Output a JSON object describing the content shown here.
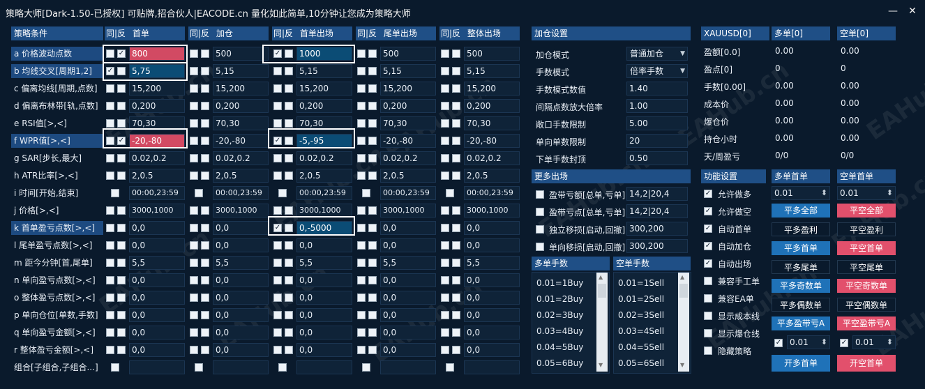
{
  "title": "策略大师[Dark-1.50-已授权]  可贴牌,招合伙人|EACODE.cn  量化如此简单,10分钟让您成为策略大师",
  "window": {
    "minimize": "—",
    "close": "✕"
  },
  "watermark": "EAHub.cn",
  "strategy": {
    "header_cond": "策略条件",
    "col_headers": [
      {
        "flag": "同|反",
        "name": "首单"
      },
      {
        "flag": "同|反",
        "name": "加仓"
      },
      {
        "flag": "同|反",
        "name": "首单出场"
      },
      {
        "flag": "同|反",
        "name": "尾单出场"
      },
      {
        "flag": "同|反",
        "name": "整体出场"
      }
    ],
    "rows": [
      {
        "label": "a 价格波动点数",
        "values": [
          "800",
          "500",
          "1000",
          "500",
          "500"
        ]
      },
      {
        "label": "b 均线交叉[周期1,2]",
        "values": [
          "5,75",
          "5,15",
          "5,15",
          "5,15",
          "5,15"
        ]
      },
      {
        "label": "c 偏离均线[周期,点数]",
        "values": [
          "15,200",
          "15,200",
          "15,200",
          "15,200",
          "15,200"
        ]
      },
      {
        "label": "d 偏离布林带[轨,点数]",
        "values": [
          "0,200",
          "0,200",
          "0,200",
          "0,200",
          "0,200"
        ]
      },
      {
        "label": "e RSI值[>,<]",
        "values": [
          "70,30",
          "70,30",
          "70,30",
          "70,30",
          "70,30"
        ]
      },
      {
        "label": "f WPR值[>,<]",
        "values": [
          "-20,-80",
          "-20,-80",
          "-5,-95",
          "-20,-80",
          "-20,-80"
        ]
      },
      {
        "label": "g SAR[步长,最大]",
        "values": [
          "0.02,0.2",
          "0.02,0.2",
          "0.02,0.2",
          "0.02,0.2",
          "0.02,0.2"
        ]
      },
      {
        "label": "h ATR比率[>,<]",
        "values": [
          "2,0.5",
          "2,0.5",
          "2,0.5",
          "2,0.5",
          "2,0.5"
        ]
      },
      {
        "label": "i 时间[开始,结束]",
        "values": [
          "00:00,23:59",
          "00:00,23:59",
          "00:00,23:59",
          "00:00,23:59",
          "00:00,23:59"
        ]
      },
      {
        "label": "j 价格[>,<]",
        "values": [
          "3000,1000",
          "3000,1000",
          "3000,1000",
          "3000,1000",
          "3000,1000"
        ]
      },
      {
        "label": "k 首单盈亏点数[>,<]",
        "values": [
          "0,0",
          "0,0",
          "0,-5000",
          "0,0",
          "0,0"
        ]
      },
      {
        "label": "l 尾单盈亏点数[>,<]",
        "values": [
          "0,0",
          "0,0",
          "0,0",
          "0,0",
          "0,0"
        ]
      },
      {
        "label": "m 距今分钟[首,尾单]",
        "values": [
          "5,5",
          "5,5",
          "5,5",
          "5,5",
          "5,5"
        ]
      },
      {
        "label": "n 单向盈亏点数[>,<]",
        "values": [
          "0,0",
          "0,0",
          "0,0",
          "0,0",
          "0,0"
        ]
      },
      {
        "label": "o 整体盈亏点数[>,<]",
        "values": [
          "0,0",
          "0,0",
          "0,0",
          "0,0",
          "0,0"
        ]
      },
      {
        "label": "p 单向仓位[单数,手数]",
        "values": [
          "0,0",
          "0,0",
          "0,0",
          "0,0",
          "0,0"
        ]
      },
      {
        "label": "q 单向盈亏金额[>,<]",
        "values": [
          "0,0",
          "0,0",
          "0,0",
          "0,0",
          "0,0"
        ]
      },
      {
        "label": "r 整体盈亏金额[>,<]",
        "values": [
          "0,0",
          "0,0",
          "0,0",
          "0,0",
          "0,0"
        ]
      },
      {
        "label": "组合[子组合,子组合...]",
        "values": [
          "",
          "",
          "",
          "",
          ""
        ]
      }
    ]
  },
  "add_settings": {
    "header": "加仓设置",
    "fields": [
      {
        "label": "加仓模式",
        "value": "普通加仓"
      },
      {
        "label": "手数模式",
        "value": "倍率手数"
      },
      {
        "label": "手数模式数值",
        "value": "1.40"
      },
      {
        "label": "间隔点数放大倍率",
        "value": "1.00"
      },
      {
        "label": "敞口手数限制",
        "value": "5.00"
      },
      {
        "label": "单向单数限制",
        "value": "20"
      },
      {
        "label": "下单手数封顶",
        "value": "0.50"
      }
    ]
  },
  "more_exits": {
    "header": "更多出场",
    "items": [
      {
        "label": "盈带亏额[总单,亏单]",
        "value": "14,2|20,4"
      },
      {
        "label": "盈带亏点[总单,亏单]",
        "value": "14,2|20,4"
      },
      {
        "label": "独立移损[启动,回撤]",
        "value": "300,200"
      },
      {
        "label": "单向移损[启动,回撤]",
        "value": "300,200"
      }
    ]
  },
  "lots": {
    "buy_header": "多单手数",
    "sell_header": "空单手数",
    "buy": [
      "0.01=1Buy",
      "0.01=2Buy",
      "0.02=3Buy",
      "0.03=4Buy",
      "0.04=5Buy",
      "0.05=6Buy"
    ],
    "sell": [
      "0.01=1Sell",
      "0.01=2Sell",
      "0.02=3Sell",
      "0.03=4Sell",
      "0.04=5Sell",
      "0.05=6Sell"
    ]
  },
  "stats": {
    "symbol": "XAUUSD[0]",
    "buy_header": "多单[0]",
    "sell_header": "空单[0]",
    "rows": [
      {
        "label": "盈额[0.0]",
        "buy": "0.00",
        "sell": "0.00"
      },
      {
        "label": "盈点[0]",
        "buy": "0",
        "sell": "0"
      },
      {
        "label": "手数[0.00]",
        "buy": "0.00",
        "sell": "0.00"
      },
      {
        "label": "成本价",
        "buy": "0.00",
        "sell": "0.00"
      },
      {
        "label": "爆仓价",
        "buy": "0.00",
        "sell": "0.00"
      },
      {
        "label": "持仓小时",
        "buy": "0.00",
        "sell": "0.00"
      },
      {
        "label": "天/周盈亏",
        "buy": "0/0",
        "sell": "0/0"
      }
    ]
  },
  "functions": {
    "header": "功能设置",
    "items": [
      {
        "label": "允许做多",
        "checked": true
      },
      {
        "label": "允许做空",
        "checked": true
      },
      {
        "label": "自动首单",
        "checked": true
      },
      {
        "label": "自动加仓",
        "checked": true
      },
      {
        "label": "自动出场",
        "checked": true
      },
      {
        "label": "兼容手工单",
        "checked": false
      },
      {
        "label": "兼容EA单",
        "checked": false
      },
      {
        "label": "显示成本线",
        "checked": false
      },
      {
        "label": "显示爆仓线",
        "checked": false
      },
      {
        "label": "隐藏策略",
        "checked": false
      }
    ]
  },
  "actions": {
    "buy_first_header": "多单首单",
    "sell_first_header": "空单首单",
    "buy_lot": "0.01",
    "sell_lot": "0.01",
    "buy_buttons": [
      "平多全部",
      "平多盈利",
      "平多首单",
      "平多尾单",
      "平多奇数单",
      "平多偶数单",
      "平多盈带亏A"
    ],
    "sell_buttons": [
      "平空全部",
      "平空盈利",
      "平空首单",
      "平空尾单",
      "平空奇数单",
      "平空偶数单",
      "平空盈带亏A"
    ],
    "buy_small_lot": "0.01",
    "sell_small_lot": "0.01",
    "open_buy": "开多首单",
    "open_sell": "开空首单"
  },
  "colors": {
    "accent_red": "#e2506c",
    "accent_blue": "#1f72b8",
    "header_bg": "#1f4f86",
    "bg": "#0a1a2c"
  }
}
